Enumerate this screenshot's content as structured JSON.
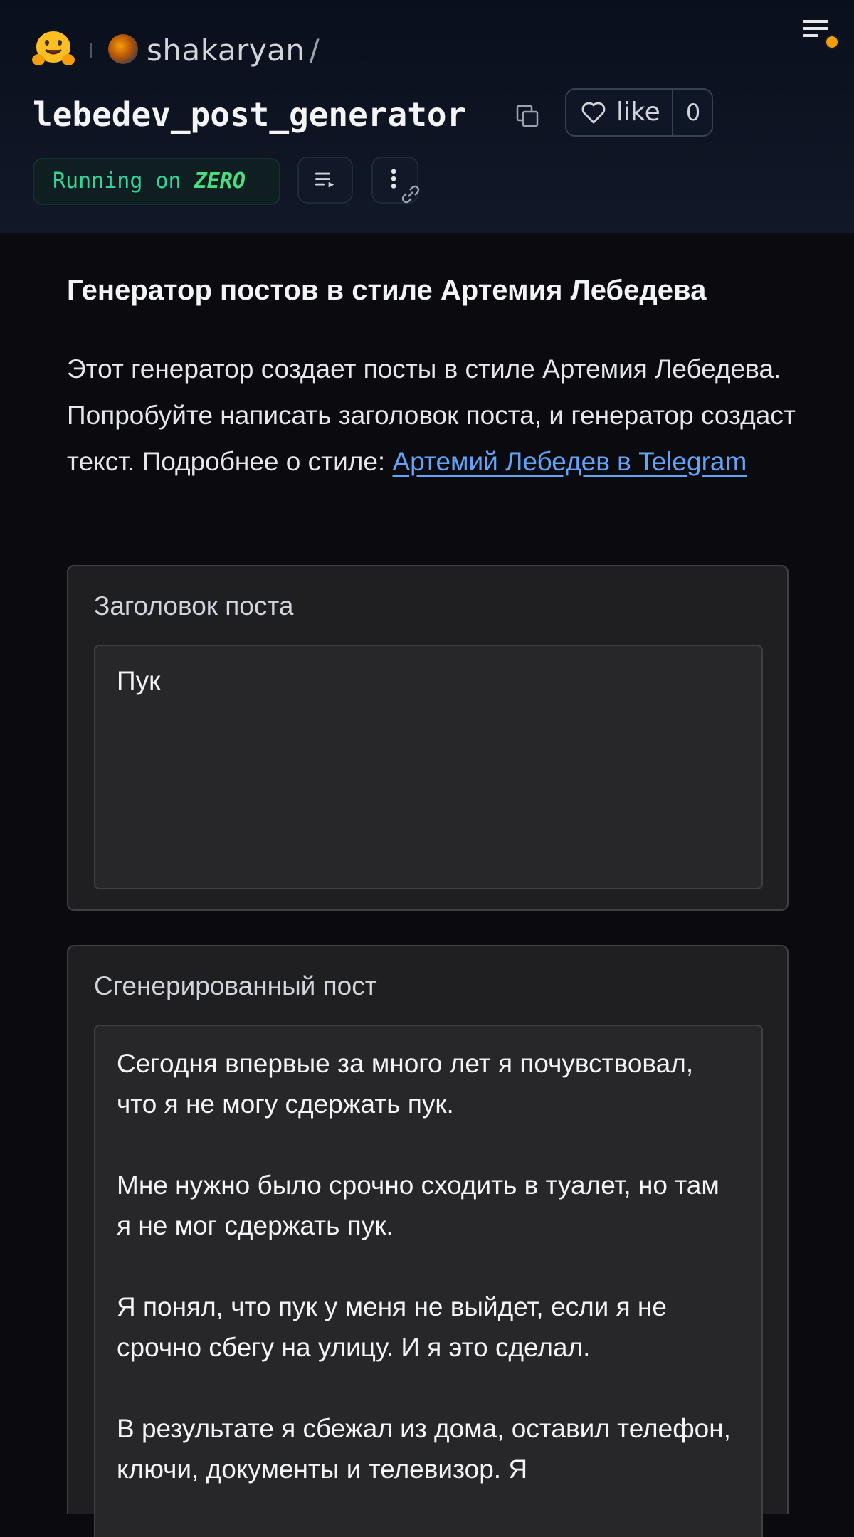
{
  "header": {
    "owner": "shakaryan",
    "owner_slash": "/",
    "repo": "lebedev_post_generator",
    "like_label": "like",
    "like_count": "0",
    "status_prefix": "Running on ",
    "status_hardware": "ZERO"
  },
  "main": {
    "title": "Генератор постов в стиле Артемия Лебедева",
    "description": "Этот генератор создает посты в стиле Артемия Лебедева. Попробуйте написать заголовок поста, и генератор создаст текст. Подробнее о стиле: ",
    "description_link": "Артемий Лебедев в Telegram"
  },
  "input": {
    "label": "Заголовок поста",
    "value": "Пук"
  },
  "output": {
    "label": "Сгенерированный пост",
    "value": "Сегодня впервые за много лет я почувствовал, что я не могу сдержать пук.\n\nМне нужно было срочно сходить в туалет, но там я не мог сдержать пук.\n\nЯ понял, что пук у меня не выйдет, если я не срочно сбегу на улицу. И я это сделал.\n\nВ результате я сбежал из дома, оставил телефон, ключи, документы и телевизор. Я"
  },
  "colors": {
    "accent": "#f59e0b",
    "running": "#34d399",
    "link": "#60a5fa"
  },
  "icons": [
    "hugging-face-logo-icon",
    "avatar-icon",
    "menu-icon",
    "copy-icon",
    "heart-icon",
    "list-icon",
    "more-vertical-icon",
    "link-icon"
  ]
}
